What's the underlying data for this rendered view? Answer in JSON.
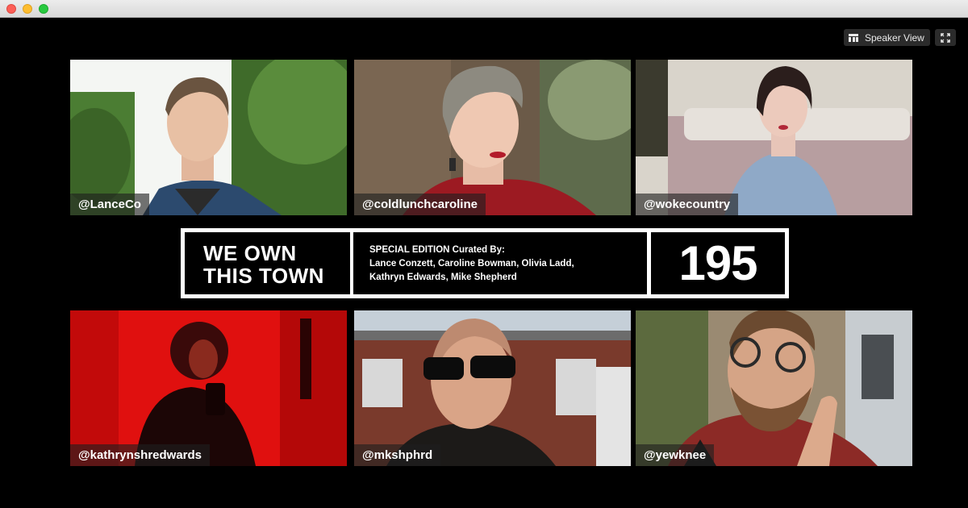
{
  "window": {
    "controls": [
      "close",
      "minimize",
      "zoom"
    ]
  },
  "toolbar": {
    "view_label": "Speaker View",
    "view_icon": "speaker-view-icon",
    "fullscreen_icon": "fullscreen-icon"
  },
  "participants": [
    {
      "name": "@LanceCo"
    },
    {
      "name": "@coldlunchcaroline"
    },
    {
      "name": "@wokecountry"
    },
    {
      "name": "@kathrynshredwards"
    },
    {
      "name": "@mkshphrd"
    },
    {
      "name": "@yewknee"
    }
  ],
  "banner": {
    "title_line1": "WE OWN",
    "title_line2": "THIS TOWN",
    "edition_line1": "SPECIAL EDITION Curated By:",
    "edition_line2": "Lance Conzett, Caroline Bowman, Olivia Ladd,",
    "edition_line3": "Kathryn Edwards, Mike Shepherd",
    "episode_number": "195"
  },
  "colors": {
    "background": "#000000",
    "banner_frame": "#ffffff",
    "nameplate": "#1e1e1e"
  }
}
